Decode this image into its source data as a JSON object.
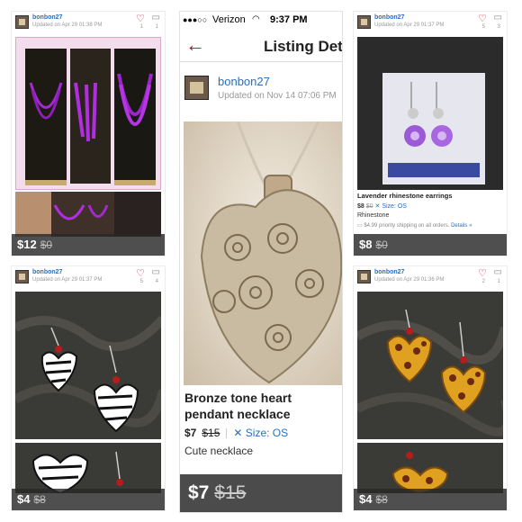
{
  "cards": [
    {
      "username": "bonbon27",
      "updated": "Updated on Apr 29 01:38 PM",
      "likes": "1",
      "comments": "1",
      "price": "$12",
      "orig": "$0"
    },
    {
      "username": "bonbon27",
      "updated": "Updated on Apr 29 01:37 PM",
      "likes": "5",
      "comments": "3",
      "price": "$8",
      "orig": "$0",
      "title": "Lavender rhinestone earrings",
      "sm_price": "$8",
      "sm_orig": "$0",
      "size": "Size: OS",
      "brand": "Rhinestone",
      "shipping": "$4.99 priority shipping on all orders.",
      "details": "Details »"
    },
    {
      "username": "bonbon27",
      "updated": "Updated on Apr 29 01:37 PM",
      "likes": "5",
      "comments": "4",
      "price": "$4",
      "orig": "$8"
    },
    {
      "username": "bonbon27",
      "updated": "Updated on Apr 29 01:36 PM",
      "likes": "2",
      "comments": "1",
      "price": "$4",
      "orig": "$8"
    }
  ],
  "phone": {
    "signal": "●●●○○",
    "carrier": "Verizon",
    "wifi": "wifi",
    "time": "9:37 PM",
    "back_icon": "back-arrow-icon",
    "nav_title": "Listing Det",
    "username": "bonbon27",
    "updated": "Updated on Nov 14 07:06 PM",
    "title": "Bronze tone heart pendant necklace",
    "price": "$7",
    "orig": "$15",
    "size": "Size: OS",
    "desc": "Cute necklace",
    "bar_price": "$7",
    "bar_orig": "$15"
  },
  "colors": {
    "accent": "#2a6fbd",
    "brand": "#8b1a2b",
    "heart": "#c8102e"
  }
}
